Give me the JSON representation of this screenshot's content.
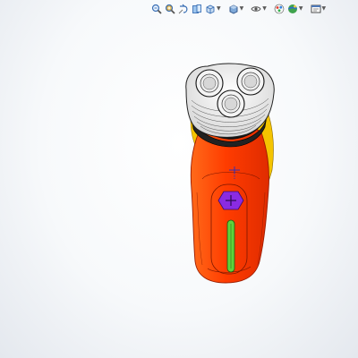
{
  "window": {
    "background": "#ffffff"
  },
  "heads_up_toolbar": {
    "buttons": [
      {
        "name": "zoom-to-fit",
        "icon": "zoom-to-fit-icon",
        "dropdown": false
      },
      {
        "name": "zoom-to-area",
        "icon": "zoom-to-area-icon",
        "dropdown": false
      },
      {
        "name": "previous-view",
        "icon": "previous-view-icon",
        "dropdown": false
      },
      {
        "name": "section-view",
        "icon": "section-view-icon",
        "dropdown": false
      },
      {
        "name": "view-orientation",
        "icon": "view-orientation-icon",
        "dropdown": true
      },
      {
        "name": "display-style",
        "icon": "display-style-icon",
        "dropdown": true
      },
      {
        "name": "hide-show-items",
        "icon": "hide-show-items-icon",
        "dropdown": true
      },
      {
        "name": "edit-appearance",
        "icon": "appearance-icon",
        "dropdown": false
      },
      {
        "name": "apply-scene",
        "icon": "scene-icon",
        "dropdown": true
      },
      {
        "name": "view-settings",
        "icon": "view-settings-icon",
        "dropdown": true
      }
    ]
  },
  "model": {
    "name": "electric-shaver",
    "colors": {
      "body": "#ff3c00",
      "body_edge": "#b02000",
      "side_trim": "#f4c400",
      "head": "#f2f2f2",
      "collar": "#222222",
      "button": "#8a2be2",
      "window": "#5fd33b",
      "origin_marker": "#2230c8"
    }
  }
}
